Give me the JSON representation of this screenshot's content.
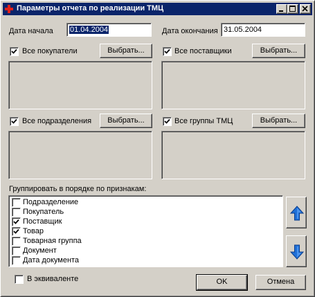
{
  "window": {
    "title": "Параметры отчета по реализации ТМЦ",
    "title_icon": "red-cross-icon",
    "controls": [
      "minimize-icon",
      "maximize-icon",
      "close-icon"
    ]
  },
  "dates": {
    "start_label": "Дата начала",
    "start_value": "01.04.2004",
    "end_label": "Дата окончания",
    "end_value": "31.05.2004"
  },
  "filters": {
    "buyers": {
      "label": "Все покупатели",
      "checked": true,
      "button": "Выбрать..."
    },
    "suppliers": {
      "label": "Все поставщики",
      "checked": true,
      "button": "Выбрать..."
    },
    "departments": {
      "label": "Все подразделения",
      "checked": true,
      "button": "Выбрать..."
    },
    "groups": {
      "label": "Все группы ТМЦ",
      "checked": true,
      "button": "Выбрать..."
    }
  },
  "grouping": {
    "label": "Группировать в порядке по признакам:",
    "items": [
      {
        "label": "Подразделение",
        "checked": false
      },
      {
        "label": "Покупатель",
        "checked": false
      },
      {
        "label": "Поставщик",
        "checked": true
      },
      {
        "label": "Товар",
        "checked": true
      },
      {
        "label": "Товарная группа",
        "checked": false
      },
      {
        "label": "Документ",
        "checked": false
      },
      {
        "label": "Дата документа",
        "checked": false
      }
    ],
    "up_icon": "arrow-up-icon",
    "down_icon": "arrow-down-icon"
  },
  "footer": {
    "equivalent_label": "В эквиваленте",
    "equivalent_checked": false,
    "ok": "OK",
    "cancel": "Отмена"
  },
  "colors": {
    "titlebar": "#0a246a",
    "face": "#d4d0c8",
    "arrow": "#1f6fd6"
  }
}
